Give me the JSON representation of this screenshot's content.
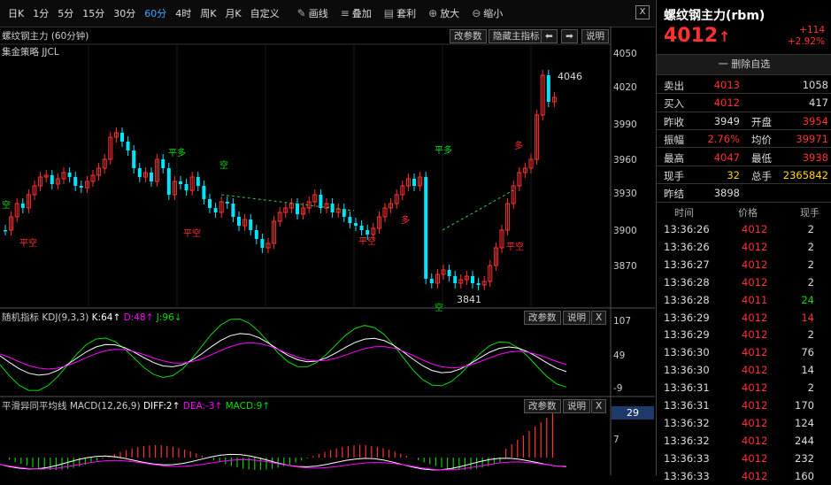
{
  "toolbar": {
    "periods": [
      "日K",
      "1分",
      "5分",
      "15分",
      "30分",
      "60分",
      "4时",
      "周K",
      "月K",
      "自定义"
    ],
    "active_period": "60分",
    "tools": [
      {
        "icon": "pencil-icon",
        "label": "画线"
      },
      {
        "icon": "layers-icon",
        "label": "叠加"
      },
      {
        "icon": "template-icon",
        "label": "套利"
      },
      {
        "icon": "zoom-in-icon",
        "label": "放大"
      },
      {
        "icon": "zoom-out-icon",
        "label": "缩小"
      }
    ],
    "close": "X"
  },
  "main": {
    "title": "螺纹钢主力 (60分钟)",
    "strategy": "集金策略 JJCL",
    "buttons": {
      "params": "改参数",
      "hide": "隐藏主指标",
      "left": "⬅",
      "right": "➡",
      "help": "说明"
    },
    "y_ticks": [
      "4050",
      "4020",
      "3990",
      "3960",
      "3930",
      "3900",
      "3870"
    ],
    "high_label": "4046",
    "low_label": "3841",
    "signals": [
      "空",
      "平空",
      "平多",
      "空",
      "平空",
      "平空",
      "平多",
      "多",
      "多",
      "平空",
      "空",
      "平多",
      "平空"
    ]
  },
  "kdj": {
    "name": "随机指标",
    "params": "KDJ(9,3,3)",
    "k": "K:64↑",
    "d": "D:48↑",
    "j": "J:96↓",
    "y_ticks": [
      "107",
      "49",
      "-9"
    ],
    "buttons": {
      "params": "改参数",
      "help": "说明",
      "close": "X"
    }
  },
  "macd": {
    "name": "平滑异同平均线",
    "params": "MACD(12,26,9)",
    "diff": "DIFF:2↑",
    "dea": "DEA:-3↑",
    "macd": "MACD:9↑",
    "value_badge": "29",
    "y_tick": "7",
    "buttons": {
      "params": "改参数",
      "help": "说明",
      "close": "X"
    }
  },
  "quote": {
    "title": "螺纹钢主力(rbm)",
    "price": "4012",
    "change": "+114",
    "change_pct": "+2.92%",
    "remove_fav": "一 删除自选",
    "rows": [
      {
        "l1": "卖出",
        "v1": "4013",
        "c1": "red",
        "l2": "",
        "v2": "1058",
        "c2": "white"
      },
      {
        "l1": "买入",
        "v1": "4012",
        "c1": "red",
        "l2": "",
        "v2": "417",
        "c2": "white"
      },
      {
        "l1": "昨收",
        "v1": "3949",
        "c1": "white",
        "l2": "开盘",
        "v2": "3954",
        "c2": "red"
      },
      {
        "l1": "振幅",
        "v1": "2.76%",
        "c1": "red",
        "l2": "均价",
        "v2": "39971",
        "c2": "red"
      },
      {
        "l1": "最高",
        "v1": "4047",
        "c1": "red",
        "l2": "最低",
        "v2": "3938",
        "c2": "red"
      },
      {
        "l1": "现手",
        "v1": "32",
        "c1": "yellow",
        "l2": "总手",
        "v2": "2365842",
        "c2": "yellow"
      },
      {
        "l1": "昨结",
        "v1": "3898",
        "c1": "white",
        "l2": "",
        "v2": "",
        "c2": "white"
      }
    ],
    "trades_header": {
      "time": "时间",
      "price": "价格",
      "vol": "现手"
    },
    "trades": [
      {
        "t": "13:36:26",
        "p": "4012",
        "v": "2",
        "c": "white"
      },
      {
        "t": "13:36:26",
        "p": "4012",
        "v": "2",
        "c": "white"
      },
      {
        "t": "13:36:27",
        "p": "4012",
        "v": "2",
        "c": "white"
      },
      {
        "t": "13:36:28",
        "p": "4012",
        "v": "2",
        "c": "white"
      },
      {
        "t": "13:36:28",
        "p": "4011",
        "v": "24",
        "c": "green"
      },
      {
        "t": "13:36:29",
        "p": "4012",
        "v": "14",
        "c": "red"
      },
      {
        "t": "13:36:29",
        "p": "4012",
        "v": "2",
        "c": "white"
      },
      {
        "t": "13:36:30",
        "p": "4012",
        "v": "76",
        "c": "white"
      },
      {
        "t": "13:36:30",
        "p": "4012",
        "v": "14",
        "c": "white"
      },
      {
        "t": "13:36:31",
        "p": "4012",
        "v": "2",
        "c": "white"
      },
      {
        "t": "13:36:31",
        "p": "4012",
        "v": "170",
        "c": "white"
      },
      {
        "t": "13:36:32",
        "p": "4012",
        "v": "124",
        "c": "white"
      },
      {
        "t": "13:36:32",
        "p": "4012",
        "v": "244",
        "c": "white"
      },
      {
        "t": "13:36:33",
        "p": "4012",
        "v": "232",
        "c": "white"
      },
      {
        "t": "13:36:33",
        "p": "4012",
        "v": "160",
        "c": "white"
      }
    ]
  },
  "colors": {
    "up": "#ff3030",
    "down": "#00e5ff",
    "k": "#ffffff",
    "d": "#ff00ff",
    "j": "#00dd00",
    "accent": "#3fa9ff"
  }
}
